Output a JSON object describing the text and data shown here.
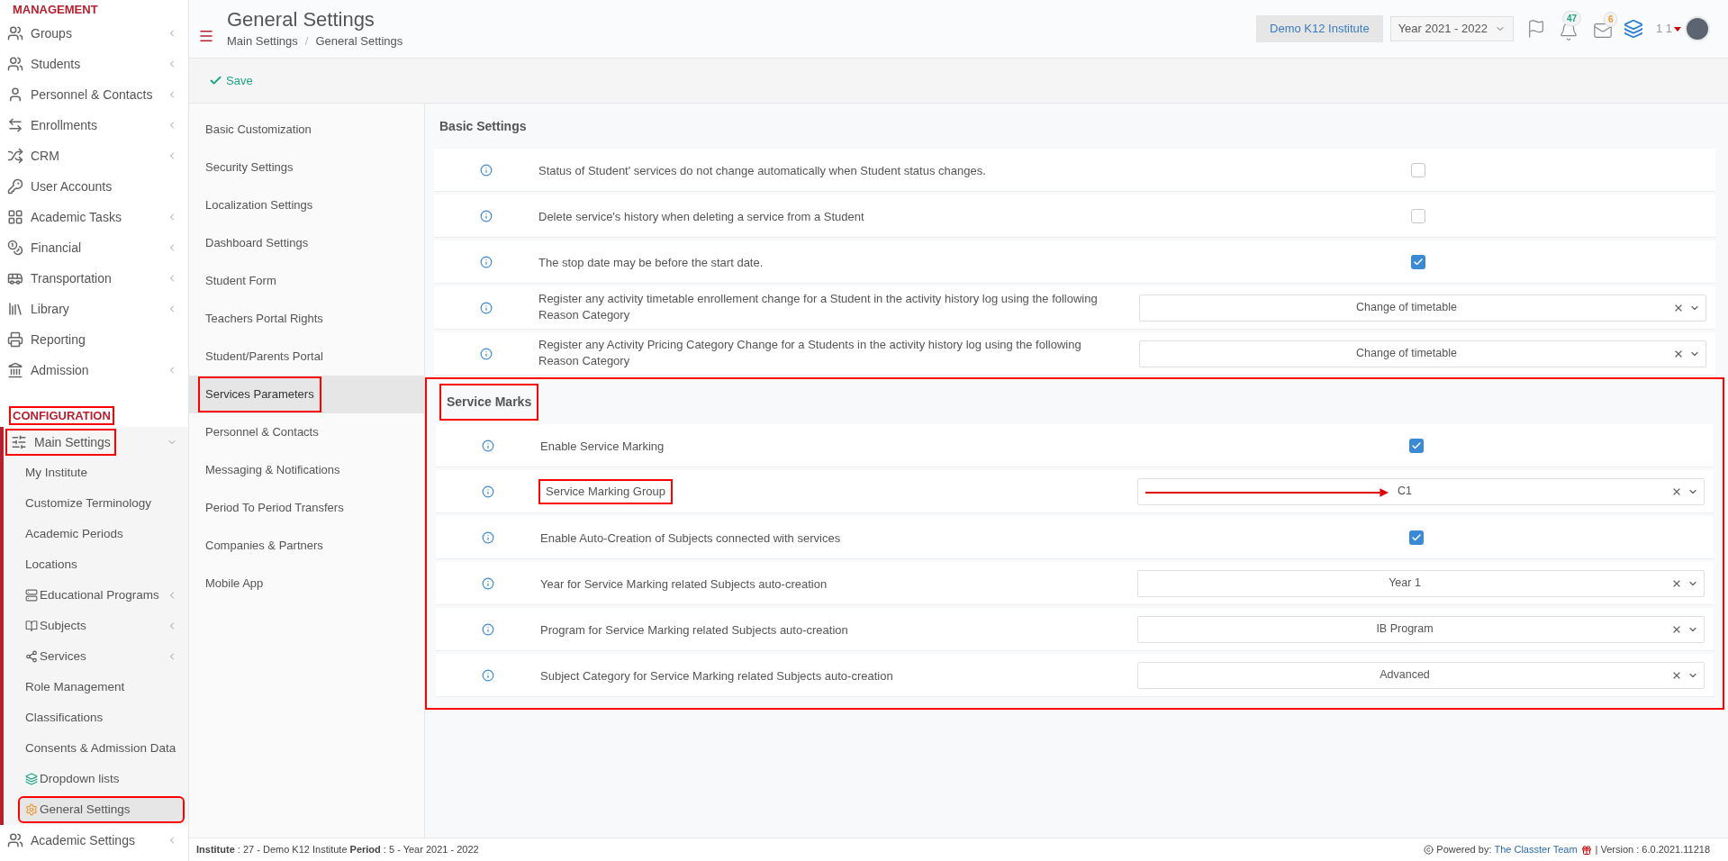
{
  "sidebar": {
    "sections": [
      {
        "title": "MANAGEMENT",
        "highlighted": false,
        "items": [
          {
            "label": "Groups",
            "has_submenu": true
          },
          {
            "label": "Students",
            "has_submenu": true
          },
          {
            "label": "Personnel & Contacts",
            "has_submenu": true
          },
          {
            "label": "Enrollments",
            "has_submenu": true
          },
          {
            "label": "CRM",
            "has_submenu": true
          },
          {
            "label": "User Accounts",
            "has_submenu": false
          },
          {
            "label": "Academic Tasks",
            "has_submenu": true
          },
          {
            "label": "Financial",
            "has_submenu": true
          },
          {
            "label": "Transportation",
            "has_submenu": true
          },
          {
            "label": "Library",
            "has_submenu": true
          },
          {
            "label": "Reporting",
            "has_submenu": false
          },
          {
            "label": "Admission",
            "has_submenu": true
          }
        ]
      },
      {
        "title": "CONFIGURATION",
        "highlighted": true,
        "items": [
          {
            "label": "Main Settings",
            "has_submenu": true,
            "expanded": true,
            "highlighted": true,
            "children": [
              {
                "label": "My Institute",
                "has_submenu": false,
                "selected": false,
                "highlighted": false
              },
              {
                "label": "Customize Terminology",
                "has_submenu": false,
                "selected": false,
                "highlighted": false
              },
              {
                "label": "Academic Periods",
                "has_submenu": false,
                "selected": false,
                "highlighted": false
              },
              {
                "label": "Locations",
                "has_submenu": false,
                "selected": false,
                "highlighted": false
              },
              {
                "label": "Educational Programs",
                "has_submenu": true,
                "selected": false,
                "highlighted": false
              },
              {
                "label": "Subjects",
                "has_submenu": true,
                "selected": false,
                "highlighted": false
              },
              {
                "label": "Services",
                "has_submenu": true,
                "selected": false,
                "highlighted": false
              },
              {
                "label": "Role Management",
                "has_submenu": false,
                "selected": false,
                "highlighted": false
              },
              {
                "label": "Classifications",
                "has_submenu": false,
                "selected": false,
                "highlighted": false
              },
              {
                "label": "Consents & Admission Data",
                "has_submenu": false,
                "selected": false,
                "highlighted": false
              },
              {
                "label": "Dropdown lists",
                "has_submenu": false,
                "selected": false,
                "highlighted": false
              },
              {
                "label": "General Settings",
                "has_submenu": false,
                "selected": true,
                "highlighted": true
              }
            ]
          },
          {
            "label": "Academic Settings",
            "has_submenu": true,
            "expanded": false,
            "highlighted": false
          }
        ]
      }
    ]
  },
  "header": {
    "title": "General Settings",
    "breadcrumb": [
      "Main Settings",
      "General Settings"
    ],
    "breadcrumb_separator": "/",
    "institute": "Demo K12 Institute",
    "year": "Year 2021 - 2022",
    "notifications": "47",
    "messages": "6",
    "user": "1 1"
  },
  "toolbar": {
    "save": "Save"
  },
  "settings_nav": [
    {
      "label": "Basic Customization",
      "selected": false,
      "highlighted": false
    },
    {
      "label": "Security Settings",
      "selected": false,
      "highlighted": false
    },
    {
      "label": "Localization Settings",
      "selected": false,
      "highlighted": false
    },
    {
      "label": "Dashboard Settings",
      "selected": false,
      "highlighted": false
    },
    {
      "label": "Student Form",
      "selected": false,
      "highlighted": false
    },
    {
      "label": "Teachers Portal Rights",
      "selected": false,
      "highlighted": false
    },
    {
      "label": "Student/Parents Portal",
      "selected": false,
      "highlighted": false
    },
    {
      "label": "Services Parameters",
      "selected": true,
      "highlighted": true
    },
    {
      "label": "Personnel & Contacts",
      "selected": false,
      "highlighted": false
    },
    {
      "label": "Messaging & Notifications",
      "selected": false,
      "highlighted": false
    },
    {
      "label": "Period To Period Transfers",
      "selected": false,
      "highlighted": false
    },
    {
      "label": "Companies & Partners",
      "selected": false,
      "highlighted": false
    },
    {
      "label": "Mobile App",
      "selected": false,
      "highlighted": false
    }
  ],
  "sections": [
    {
      "title": "Basic Settings",
      "highlighted": false,
      "rows": [
        {
          "kind": "checkbox",
          "label": "Status of Student' services do not change automatically when Student status changes.",
          "checked": false
        },
        {
          "kind": "checkbox",
          "label": "Delete service's history when deleting a service from a Student",
          "checked": false
        },
        {
          "kind": "checkbox",
          "label": "The stop date may be before the start date.",
          "checked": true
        },
        {
          "kind": "select",
          "label": "Register any activity timetable enrollement change for a Student in the activity history log using the following Reason Category",
          "value": "Change of timetable"
        },
        {
          "kind": "select",
          "label": "Register any Activity Pricing Category Change for a Students in the activity history log using the following Reason Category",
          "value": "Change of timetable"
        }
      ]
    },
    {
      "title": "Service Marks",
      "highlighted": true,
      "rows": [
        {
          "kind": "checkbox",
          "label": "Enable Service Marking",
          "checked": true
        },
        {
          "kind": "select",
          "label": "Service Marking Group",
          "value": "C1",
          "label_highlighted": true,
          "arrow": true
        },
        {
          "kind": "checkbox",
          "label": "Enable Auto-Creation of Subjects connected with services",
          "checked": true
        },
        {
          "kind": "select",
          "label": "Year for Service Marking related Subjects auto-creation",
          "value": "Year 1"
        },
        {
          "kind": "select",
          "label": "Program for Service Marking related Subjects auto-creation",
          "value": "IB Program"
        },
        {
          "kind": "select",
          "label": "Subject Category for Service Marking related Subjects auto-creation",
          "value": "Advanced"
        }
      ]
    }
  ],
  "footer": {
    "info": "**Institute** : 27 - Demo K12 Institute **Period** : 5 - Year 2021 - 2022",
    "powered": "Powered by:",
    "team": "The Classter Team",
    "version": "| Version : 6.0.2021.11218"
  }
}
